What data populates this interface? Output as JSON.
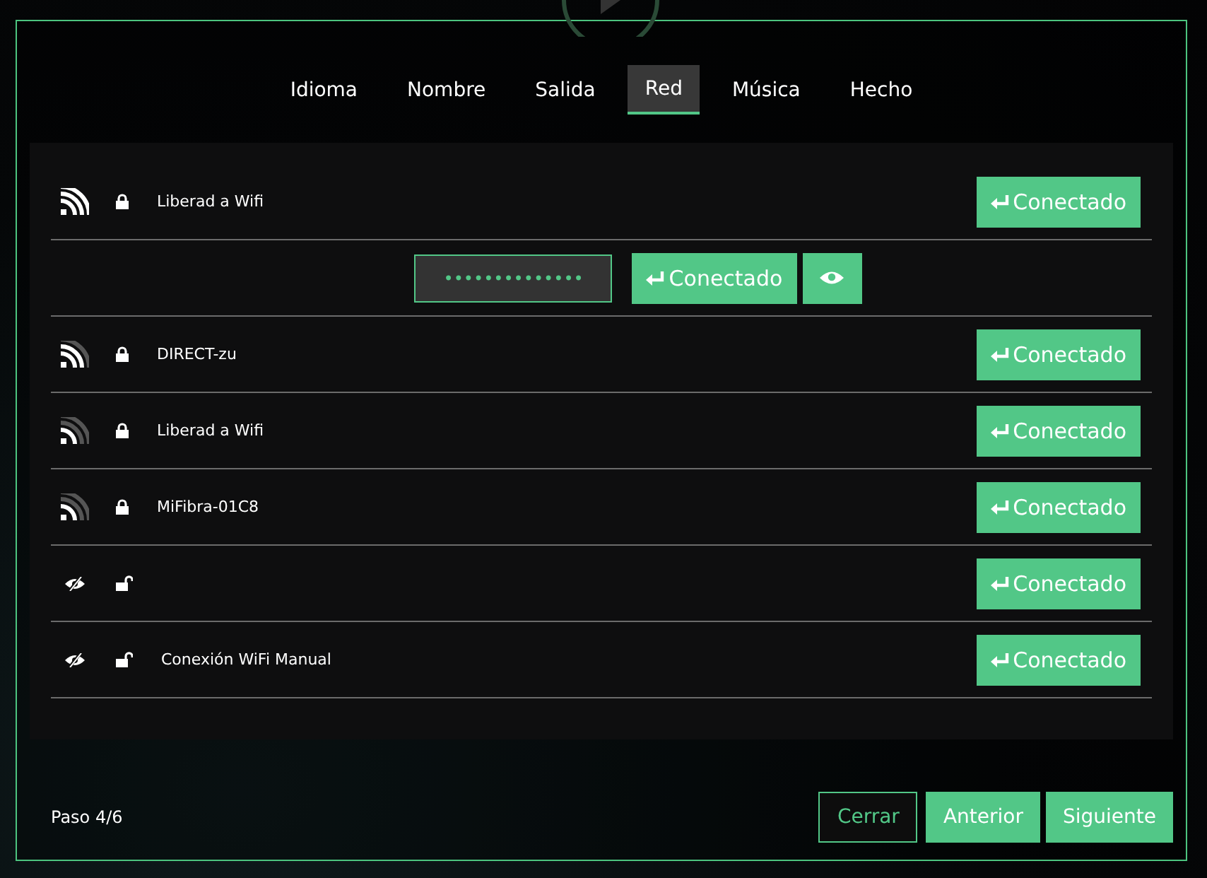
{
  "tabs": [
    {
      "label": "Idioma",
      "selected": false
    },
    {
      "label": "Nombre",
      "selected": false
    },
    {
      "label": "Salida",
      "selected": false
    },
    {
      "label": "Red",
      "selected": true
    },
    {
      "label": "Música",
      "selected": false
    },
    {
      "label": "Hecho",
      "selected": false
    }
  ],
  "networks": [
    {
      "kind": "wifi-strong",
      "secured": true,
      "name": "Liberad a Wifi",
      "button": "Conectado",
      "expanded": true,
      "password": "••••••••••••••",
      "password_button": "Conectado"
    },
    {
      "kind": "wifi-medium",
      "secured": true,
      "name": "DIRECT-zu",
      "button": "Conectado",
      "expanded": false
    },
    {
      "kind": "wifi-weak",
      "secured": true,
      "name": "Liberad a Wifi",
      "button": "Conectado",
      "expanded": false
    },
    {
      "kind": "wifi-weak",
      "secured": true,
      "name": "MiFibra-01C8",
      "button": "Conectado",
      "expanded": false
    },
    {
      "kind": "hidden",
      "secured": false,
      "button": "Conectado",
      "expanded": false
    },
    {
      "kind": "hidden",
      "secured": false,
      "name": "Conexión WiFi Manual",
      "button": "Conectado",
      "expanded": false
    }
  ],
  "footer": {
    "step": "Paso 4/6",
    "buttons": [
      {
        "label": "Cerrar",
        "kind": "outline"
      },
      {
        "label": "Anterior",
        "kind": "solid"
      },
      {
        "label": "Siguiente",
        "kind": "solid"
      }
    ]
  }
}
